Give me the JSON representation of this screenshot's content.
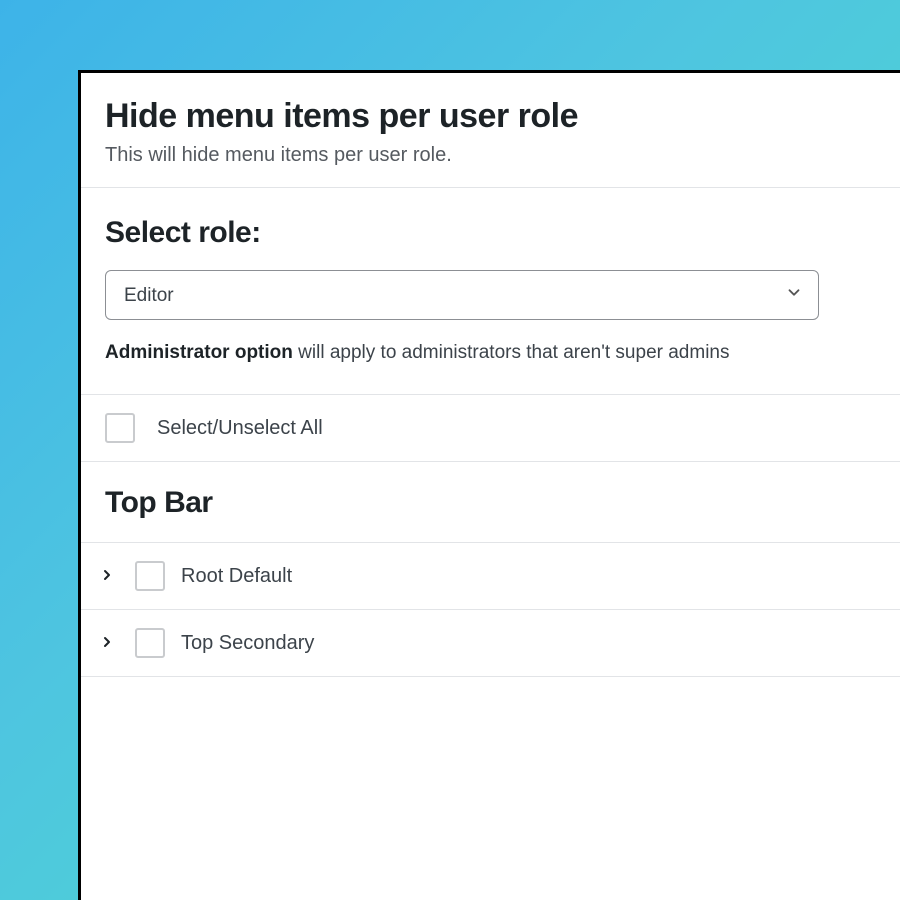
{
  "header": {
    "title": "Hide menu items per user role",
    "subtitle": "This will hide menu items per user role."
  },
  "role_selector": {
    "label": "Select role:",
    "selected": "Editor"
  },
  "admin_note": {
    "bold_part": "Administrator option",
    "rest": " will apply to administrators that aren't super admins"
  },
  "select_all": {
    "label": "Select/Unselect All"
  },
  "top_bar": {
    "heading": "Top Bar",
    "items": [
      {
        "label": "Root Default"
      },
      {
        "label": "Top Secondary"
      }
    ]
  }
}
